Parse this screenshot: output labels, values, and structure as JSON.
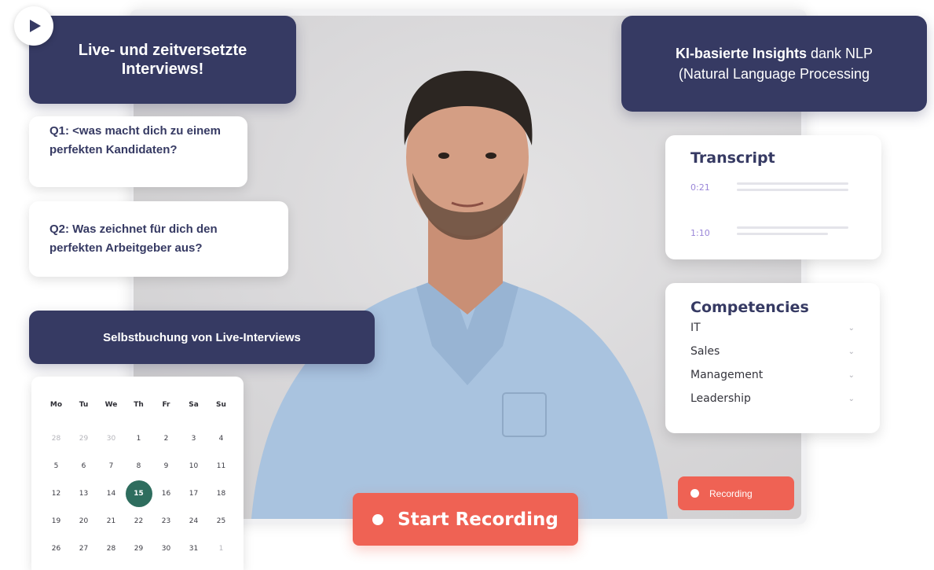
{
  "headline": "Live- und zeitversetzte Interviews!",
  "insights": {
    "bold": "KI-basierte Insights",
    "rest": " dank NLP",
    "line2": "(Natural Language Processing"
  },
  "questions": [
    "Q1: <was macht dich zu einem perfekten Kandidaten?",
    "Q2:  Was zeichnet für dich den perfekten Arbeitgeber aus?"
  ],
  "booking_label": "Selbstbuchung von Live-Interviews",
  "calendar": {
    "weekdays": [
      "Mo",
      "Tu",
      "We",
      "Th",
      "Fr",
      "Sa",
      "Su"
    ],
    "weeks": [
      [
        "28",
        "29",
        "30",
        "1",
        "2",
        "3",
        "4"
      ],
      [
        "5",
        "6",
        "7",
        "8",
        "9",
        "10",
        "11"
      ],
      [
        "12",
        "13",
        "14",
        "15",
        "16",
        "17",
        "18"
      ],
      [
        "19",
        "20",
        "21",
        "22",
        "23",
        "24",
        "25"
      ],
      [
        "26",
        "27",
        "28",
        "29",
        "30",
        "31",
        "1"
      ]
    ],
    "selected": "15",
    "selected_color": "#2e6d5e"
  },
  "transcript": {
    "title": "Transcript",
    "entries": [
      {
        "time": "0:21"
      },
      {
        "time": "1:10"
      }
    ]
  },
  "competencies": {
    "title": "Competencies",
    "items": [
      "IT",
      "Sales",
      "Management",
      "Leadership"
    ]
  },
  "recording_badge": "Recording",
  "start_button": "Start Recording",
  "colors": {
    "navy": "#363a63",
    "accent_red": "#ef6254",
    "time_purple": "#9a86d8"
  }
}
